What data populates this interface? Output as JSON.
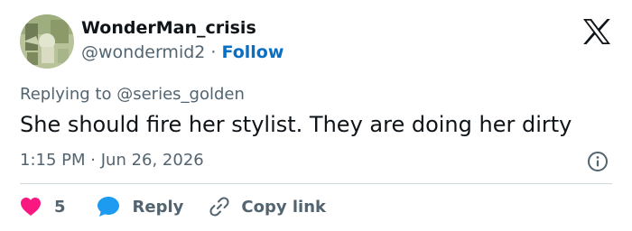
{
  "user": {
    "display_name": "WonderMan_crisis",
    "handle": "@wondermid2",
    "separator": "·",
    "follow_label": "Follow"
  },
  "reply_context": {
    "prefix": "Replying to",
    "mention": "@series_golden"
  },
  "tweet": {
    "text": "She should fire her stylist. They are doing her dirty",
    "time": "1:15 PM",
    "separator": "·",
    "date": "Jun 26, 2026"
  },
  "actions": {
    "like_count": "5",
    "reply_label": "Reply",
    "copy_link_label": "Copy link"
  },
  "icons": {
    "brand": "x-logo-icon",
    "info": "info-icon",
    "like": "heart-icon",
    "reply": "speech-bubble-icon",
    "copy": "link-icon"
  },
  "colors": {
    "text_primary": "#0f1419",
    "text_secondary": "#536471",
    "follow_link": "#0a6fc2",
    "like_heart": "#f91880",
    "reply_bubble": "#1d9bf0",
    "divider": "#cfd9de"
  }
}
